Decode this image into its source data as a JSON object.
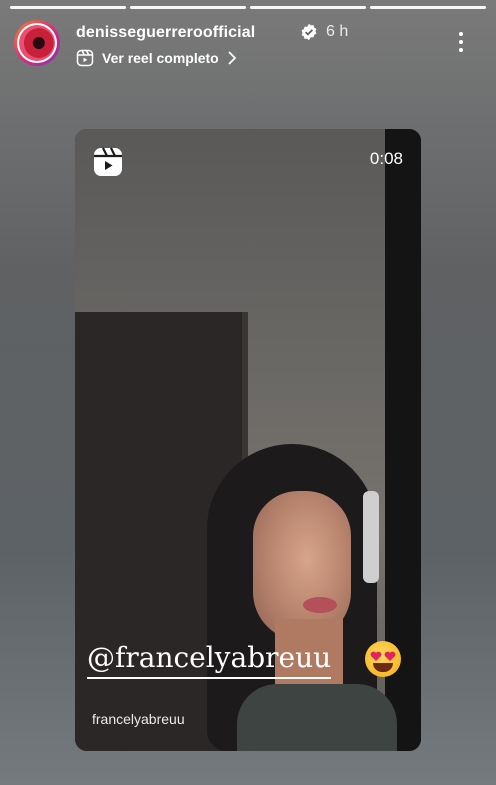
{
  "progress": {
    "segments": 4,
    "completed": 4
  },
  "header": {
    "username": "denisseguerreroofficial",
    "time": "6 h",
    "reel_link_label": "Ver reel completo",
    "avatar_icon": "avatar-image"
  },
  "reel": {
    "duration": "0:08",
    "mention": "@francelyabreuu",
    "emoji": "😍",
    "credit": "francelyabreuu"
  },
  "colors": {
    "verified": "#ffffff",
    "accent_ring": "#dd2a7b"
  }
}
